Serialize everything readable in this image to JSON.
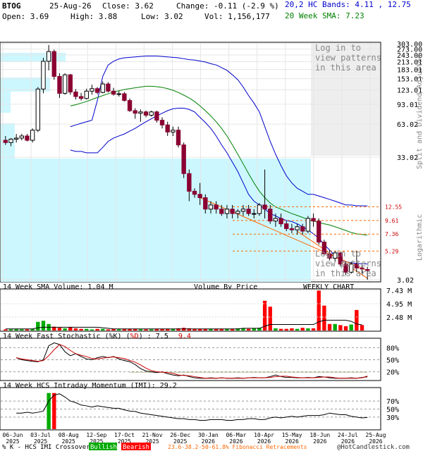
{
  "header": {
    "symbol": "BTOG",
    "date": "25-Aug-26",
    "close": "Close: 3.62",
    "change": "Change: -0.11 (-2.9 %)",
    "bands": "20,2 HC Bands: 4.11 , 12.75",
    "open": "Open: 3.69",
    "high": "High: 3.88",
    "low": "Low: 3.02",
    "vol": "Vol: 1,156,177",
    "sma": "20 Week SMA: 7.23"
  },
  "price_panel": {
    "side_label": "Split and Dividend Adjusted",
    "side_label2": "Logarithmic",
    "login_msg": [
      "Log in to",
      "view patterns",
      "in this area"
    ],
    "login_msg2": [
      "Log in to",
      "view patterns",
      "in this area"
    ],
    "volume_by_price": "Volume By Price",
    "weekly": "WEEKLY CHART",
    "price_ticks": [
      "303.00",
      "273.00",
      "243.00",
      "213.01",
      "183.01",
      "153.01",
      "123.01",
      "93.01",
      "63.02",
      "33.02",
      "3.02"
    ],
    "fib_labels": [
      "12.55",
      "9.61",
      "7.36",
      "5.29"
    ]
  },
  "volume_panel": {
    "label": "14 Week SMA Volume: 1.04 M",
    "ticks": [
      "7.43 M",
      "4.95 M",
      "2.48 M"
    ]
  },
  "stoch_panel": {
    "label_a": "14 Week Fast Stochastic (%K)",
    "label_b": "%D",
    "k_value": "7.5",
    "d_value": "9.4",
    "ticks": [
      "80%",
      "50%",
      "20%"
    ]
  },
  "imi_panel": {
    "label": "14 Week HCS Intraday Momentum (IMI): 29.2",
    "ticks": [
      "70%",
      "50%",
      "30%"
    ]
  },
  "x_axis": {
    "dates": [
      [
        "06-Jun",
        "2025"
      ],
      [
        "03-Jul",
        "2025"
      ],
      [
        "08-Aug",
        "2025"
      ],
      [
        "12-Sep",
        "2025"
      ],
      [
        "17-Oct",
        "2025"
      ],
      [
        "21-Nov",
        "2025"
      ],
      [
        "26-Dec",
        "2025"
      ],
      [
        "30-Jan",
        "2026"
      ],
      [
        "06-Mar",
        "2026"
      ],
      [
        "10-Apr",
        "2026"
      ],
      [
        "15-May",
        "2026"
      ],
      [
        "18-Jun",
        "2026"
      ],
      [
        "24-Jul",
        "2026"
      ],
      [
        "25-Aug",
        "2026"
      ]
    ]
  },
  "footer": {
    "crossover": "% K - HCS IMI Crossover:",
    "bullish": "Bullish",
    "bearish": "Bearish",
    "fib": "23.6-38.2-50-61.8% Fibonacci Retracements",
    "copyright": "@HotCandlestick.com"
  },
  "colors": {
    "up": "#ffffff",
    "down": "#8b0033",
    "blue_band": "#0000cc",
    "sma": "#008000",
    "volbar_up": "#00aa00",
    "volbar_down": "#ff0000",
    "bg_cyan": "#ccf7ff",
    "fib": "#ff6600"
  },
  "chart_data": [
    {
      "type": "candlestick",
      "title": "BTOG weekly",
      "scale": "log",
      "ylim": [
        3.02,
        303.0
      ],
      "weeks": [
        {
          "o": 46,
          "h": 50,
          "l": 42,
          "c": 44
        },
        {
          "o": 44,
          "h": 48,
          "l": 41,
          "c": 47
        },
        {
          "o": 47,
          "h": 52,
          "l": 44,
          "c": 48
        },
        {
          "o": 48,
          "h": 52,
          "l": 46,
          "c": 50
        },
        {
          "o": 50,
          "h": 52,
          "l": 45,
          "c": 46
        },
        {
          "o": 46,
          "h": 58,
          "l": 44,
          "c": 56
        },
        {
          "o": 56,
          "h": 130,
          "l": 54,
          "c": 125
        },
        {
          "o": 125,
          "h": 230,
          "l": 115,
          "c": 215
        },
        {
          "o": 215,
          "h": 295,
          "l": 180,
          "c": 260
        },
        {
          "o": 260,
          "h": 270,
          "l": 150,
          "c": 160
        },
        {
          "o": 160,
          "h": 170,
          "l": 105,
          "c": 115
        },
        {
          "o": 115,
          "h": 170,
          "l": 112,
          "c": 165
        },
        {
          "o": 165,
          "h": 168,
          "l": 112,
          "c": 118
        },
        {
          "o": 118,
          "h": 125,
          "l": 102,
          "c": 108
        },
        {
          "o": 108,
          "h": 116,
          "l": 100,
          "c": 104
        },
        {
          "o": 104,
          "h": 126,
          "l": 102,
          "c": 120
        },
        {
          "o": 120,
          "h": 136,
          "l": 112,
          "c": 126
        },
        {
          "o": 126,
          "h": 130,
          "l": 113,
          "c": 117
        },
        {
          "o": 117,
          "h": 145,
          "l": 115,
          "c": 138
        },
        {
          "o": 138,
          "h": 143,
          "l": 117,
          "c": 120
        },
        {
          "o": 120,
          "h": 128,
          "l": 110,
          "c": 113
        },
        {
          "o": 113,
          "h": 120,
          "l": 108,
          "c": 114
        },
        {
          "o": 114,
          "h": 118,
          "l": 98,
          "c": 100
        },
        {
          "o": 100,
          "h": 104,
          "l": 80,
          "c": 82
        },
        {
          "o": 82,
          "h": 86,
          "l": 70,
          "c": 78
        },
        {
          "o": 78,
          "h": 84,
          "l": 66,
          "c": 80
        },
        {
          "o": 80,
          "h": 82,
          "l": 72,
          "c": 75
        },
        {
          "o": 75,
          "h": 82,
          "l": 73,
          "c": 80
        },
        {
          "o": 80,
          "h": 82,
          "l": 65,
          "c": 68
        },
        {
          "o": 68,
          "h": 72,
          "l": 58,
          "c": 62
        },
        {
          "o": 62,
          "h": 66,
          "l": 50,
          "c": 54
        },
        {
          "o": 54,
          "h": 60,
          "l": 50,
          "c": 56
        },
        {
          "o": 56,
          "h": 60,
          "l": 40,
          "c": 42
        },
        {
          "o": 42,
          "h": 44,
          "l": 22,
          "c": 24
        },
        {
          "o": 24,
          "h": 26,
          "l": 14,
          "c": 17
        },
        {
          "o": 17,
          "h": 18,
          "l": 15,
          "c": 16
        },
        {
          "o": 16,
          "h": 20,
          "l": 13,
          "c": 15
        },
        {
          "o": 15,
          "h": 16,
          "l": 11,
          "c": 12
        },
        {
          "o": 12,
          "h": 14,
          "l": 11,
          "c": 13
        },
        {
          "o": 13,
          "h": 14,
          "l": 11,
          "c": 12
        },
        {
          "o": 12,
          "h": 13,
          "l": 10.5,
          "c": 11
        },
        {
          "o": 11,
          "h": 13,
          "l": 10,
          "c": 12
        },
        {
          "o": 12,
          "h": 13,
          "l": 10,
          "c": 11
        },
        {
          "o": 11,
          "h": 12,
          "l": 10,
          "c": 11.5
        },
        {
          "o": 11.5,
          "h": 13,
          "l": 10.5,
          "c": 12
        },
        {
          "o": 12,
          "h": 13,
          "l": 10.5,
          "c": 11
        },
        {
          "o": 11,
          "h": 12,
          "l": 10,
          "c": 11
        },
        {
          "o": 11,
          "h": 13.5,
          "l": 10.5,
          "c": 13
        },
        {
          "o": 13,
          "h": 26,
          "l": 10,
          "c": 12
        },
        {
          "o": 12,
          "h": 13,
          "l": 9,
          "c": 9.5
        },
        {
          "o": 9.5,
          "h": 11,
          "l": 8.5,
          "c": 10
        },
        {
          "o": 10,
          "h": 11,
          "l": 8.5,
          "c": 9
        },
        {
          "o": 9,
          "h": 9.5,
          "l": 7.8,
          "c": 8.2
        },
        {
          "o": 8.2,
          "h": 9,
          "l": 7.5,
          "c": 8
        },
        {
          "o": 8,
          "h": 9,
          "l": 7.3,
          "c": 8.5
        },
        {
          "o": 8.5,
          "h": 9,
          "l": 7.3,
          "c": 7.8
        },
        {
          "o": 7.8,
          "h": 10.5,
          "l": 7.5,
          "c": 10
        },
        {
          "o": 10,
          "h": 11,
          "l": 8.5,
          "c": 9.5
        },
        {
          "o": 9.5,
          "h": 10,
          "l": 6,
          "c": 6.3
        },
        {
          "o": 6.3,
          "h": 6.6,
          "l": 4.8,
          "c": 5
        },
        {
          "o": 5,
          "h": 5.4,
          "l": 4.4,
          "c": 4.6
        },
        {
          "o": 4.6,
          "h": 5.3,
          "l": 4.3,
          "c": 5.1
        },
        {
          "o": 5.1,
          "h": 5.2,
          "l": 3.9,
          "c": 4.1
        },
        {
          "o": 4.1,
          "h": 4.3,
          "l": 3.3,
          "c": 3.5
        },
        {
          "o": 3.5,
          "h": 4.3,
          "l": 3.4,
          "c": 4.1
        },
        {
          "o": 4.1,
          "h": 5.3,
          "l": 3.5,
          "c": 3.8
        },
        {
          "o": 3.8,
          "h": 4.0,
          "l": 3.4,
          "c": 3.73
        },
        {
          "o": 3.69,
          "h": 3.88,
          "l": 3.02,
          "c": 3.62
        }
      ],
      "bands_upper": [
        60,
        62,
        64,
        66,
        68,
        100,
        160,
        200,
        215,
        225,
        230,
        232,
        234,
        236,
        238,
        238,
        238,
        236,
        234,
        232,
        230,
        226,
        222,
        220,
        216,
        212,
        205,
        200,
        190,
        180,
        165,
        150,
        130,
        110,
        95,
        80,
        60,
        45,
        35,
        28,
        23,
        20,
        18,
        17,
        16,
        16,
        15.5,
        15,
        14.5,
        14,
        13.5,
        13,
        13,
        12.8,
        12.8,
        12.75
      ],
      "bands_lower": [
        38,
        37,
        37,
        36,
        36,
        36,
        40,
        45,
        48,
        50,
        52,
        55,
        58,
        62,
        66,
        70,
        74,
        78,
        82,
        85,
        86,
        86,
        84,
        80,
        72,
        65,
        58,
        50,
        42,
        36,
        30,
        25,
        20,
        16,
        14,
        13,
        12,
        11,
        10.5,
        10,
        9.6,
        9.4,
        9.0,
        8.5,
        8.0,
        7.4,
        6.8,
        6.0,
        5.4,
        4.8,
        4.5,
        4.3,
        4.2,
        4.15,
        4.12,
        4.11
      ],
      "sma_20": [
        90,
        92,
        95,
        98,
        102,
        106,
        110,
        114,
        118,
        121,
        124,
        126,
        128,
        130,
        132,
        132,
        131,
        129,
        126,
        122,
        117,
        111,
        105,
        98,
        90,
        82,
        74,
        66,
        58,
        50,
        42,
        35,
        29,
        24,
        20,
        17,
        15,
        13.5,
        12.5,
        12,
        11.5,
        11,
        10.6,
        10.2,
        9.8,
        9.5,
        9.2,
        9.0,
        8.8,
        8.5,
        8.2,
        7.9,
        7.6,
        7.4,
        7.3,
        7.23
      ],
      "fibonacci": [
        12.55,
        9.61,
        7.36,
        5.29
      ]
    },
    {
      "type": "bar",
      "title": "14 Week SMA Volume",
      "units": "M",
      "ylim": [
        0,
        7.43
      ],
      "values": [
        0.2,
        0.2,
        0.3,
        0.2,
        0.2,
        0.3,
        1.6,
        1.8,
        1.2,
        0.7,
        0.5,
        0.4,
        0.6,
        0.4,
        0.3,
        0.3,
        0.2,
        0.3,
        0.3,
        0.2,
        0.3,
        0.2,
        0.3,
        0.3,
        0.3,
        0.2,
        0.2,
        0.2,
        0.3,
        0.3,
        0.3,
        0.3,
        0.4,
        0.5,
        0.4,
        0.3,
        0.3,
        0.3,
        0.3,
        0.3,
        0.3,
        0.3,
        0.3,
        0.4,
        0.4,
        0.3,
        0.4,
        0.5,
        5.5,
        4.4,
        0.4,
        0.3,
        0.3,
        0.4,
        0.3,
        0.5,
        0.4,
        0.4,
        7.4,
        4.6,
        1.2,
        1.2,
        1.0,
        0.8,
        1.1,
        3.8,
        1.0
      ],
      "sma": [
        0.3,
        0.3,
        0.3,
        0.3,
        0.3,
        0.3,
        0.5,
        0.6,
        0.6,
        0.6,
        0.6,
        0.6,
        0.6,
        0.6,
        0.6,
        0.6,
        0.6,
        0.6,
        0.5,
        0.4,
        0.3,
        0.3,
        0.3,
        0.3,
        0.3,
        0.3,
        0.3,
        0.3,
        0.3,
        0.3,
        0.3,
        0.3,
        0.3,
        0.3,
        0.3,
        0.3,
        0.3,
        0.3,
        0.3,
        0.3,
        0.3,
        0.3,
        0.3,
        0.3,
        0.4,
        0.4,
        0.4,
        0.4,
        0.8,
        1.1,
        1.1,
        1.1,
        1.1,
        1.1,
        1.1,
        1.1,
        1.1,
        1.1,
        1.6,
        1.9,
        1.9,
        1.9,
        1.9,
        1.9,
        1.7,
        1.2,
        1.04
      ]
    },
    {
      "type": "line",
      "title": "14 Week Fast Stochastic",
      "ylim": [
        0,
        100
      ],
      "k": [
        55,
        50,
        48,
        46,
        45,
        50,
        85,
        92,
        88,
        70,
        60,
        65,
        58,
        52,
        50,
        55,
        58,
        55,
        58,
        52,
        48,
        45,
        38,
        28,
        22,
        20,
        18,
        20,
        15,
        12,
        10,
        12,
        8,
        5,
        4,
        4,
        5,
        4,
        5,
        4,
        4,
        5,
        4,
        5,
        6,
        5,
        5,
        8,
        12,
        8,
        6,
        6,
        5,
        5,
        6,
        5,
        8,
        7,
        5,
        4,
        4,
        4,
        5,
        4,
        6,
        7.5
      ],
      "d": [
        55,
        52,
        50,
        48,
        46,
        48,
        60,
        75,
        88,
        83,
        73,
        65,
        61,
        58,
        53,
        52,
        54,
        56,
        57,
        55,
        53,
        48,
        44,
        37,
        29,
        23,
        20,
        19,
        18,
        16,
        12,
        11,
        10,
        8,
        6,
        4,
        4,
        4,
        5,
        4,
        4,
        4,
        4,
        5,
        5,
        5,
        5,
        6,
        8,
        9,
        9,
        7,
        6,
        5,
        5,
        5,
        6,
        7,
        7,
        5,
        4,
        4,
        4,
        4,
        5,
        9.4
      ]
    },
    {
      "type": "line",
      "title": "14 Week HCS Intraday Momentum",
      "ylim": [
        0,
        100
      ],
      "values": [
        40,
        40,
        42,
        40,
        42,
        45,
        70,
        85,
        88,
        80,
        70,
        66,
        60,
        58,
        55,
        58,
        56,
        54,
        52,
        52,
        48,
        45,
        44,
        40,
        38,
        36,
        34,
        32,
        30,
        28,
        26,
        26,
        24,
        24,
        22,
        22,
        24,
        24,
        24,
        22,
        22,
        24,
        24,
        26,
        26,
        24,
        24,
        28,
        30,
        28,
        30,
        32,
        30,
        32,
        34,
        34,
        34,
        36,
        40,
        38,
        36,
        36,
        32,
        30,
        28,
        29.2
      ],
      "bull_weeks": [
        6
      ],
      "bear_weeks": [
        7
      ]
    }
  ]
}
